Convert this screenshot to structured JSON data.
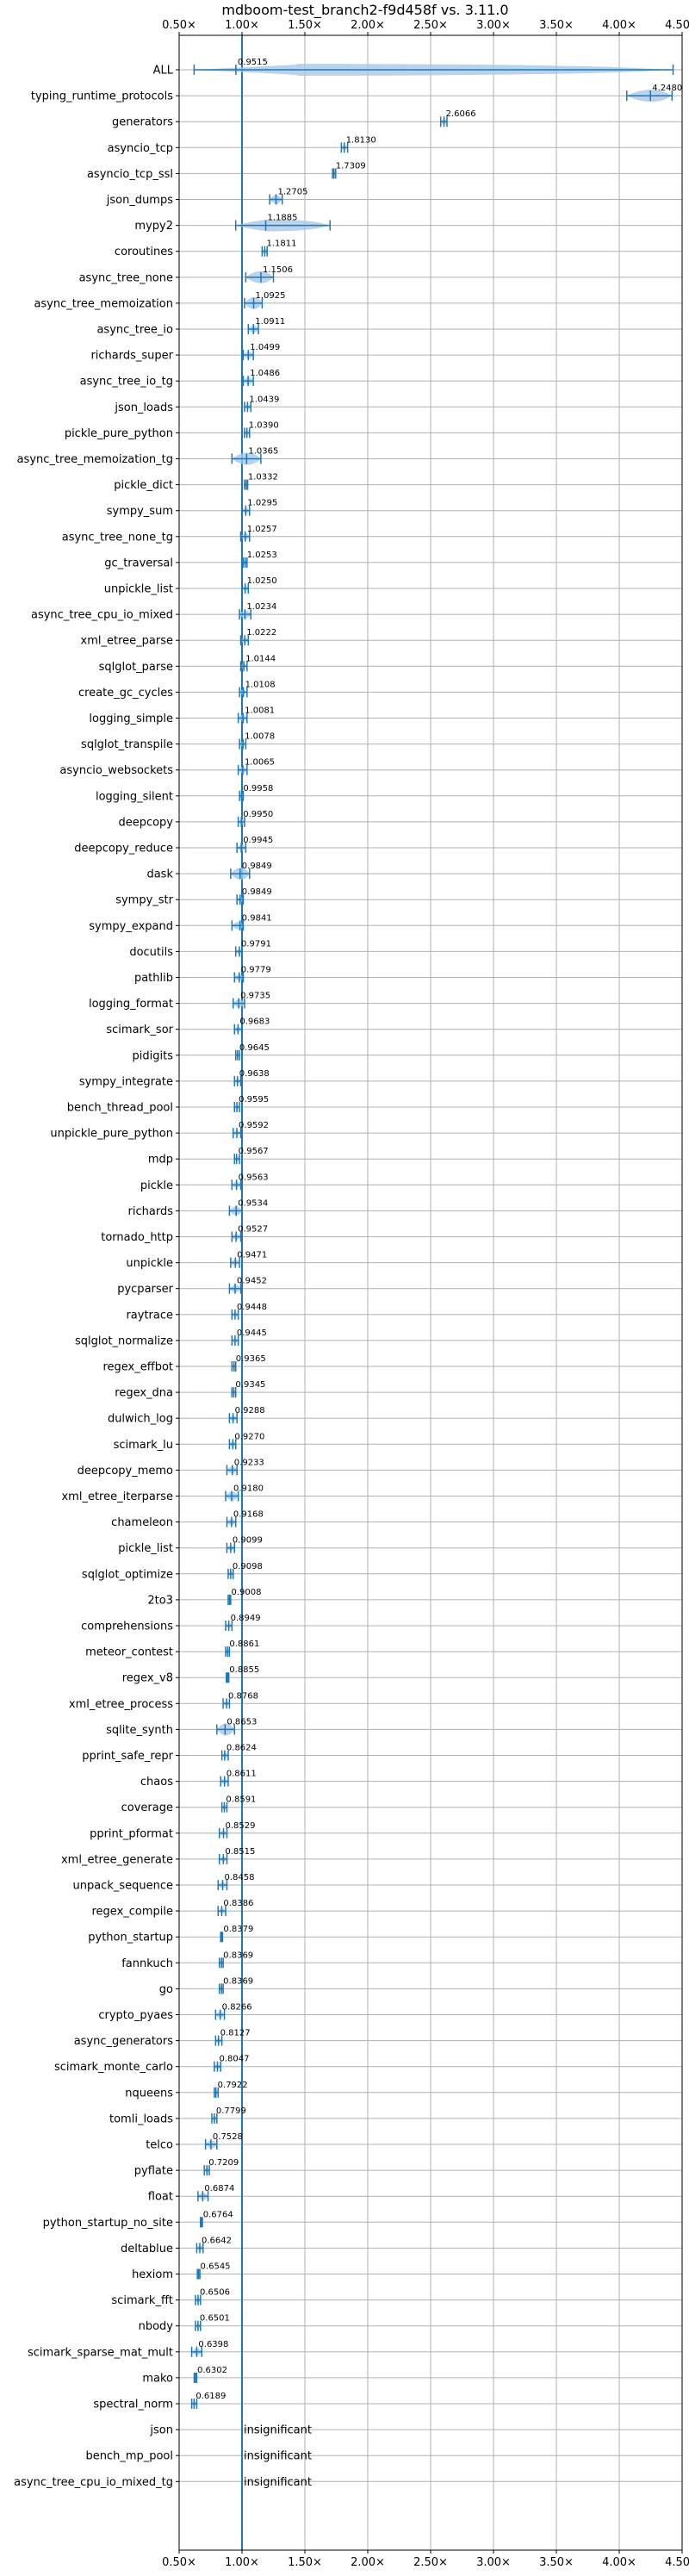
{
  "chart_data": {
    "type": "violin",
    "title": "mdboom-test_branch2-f9d458f vs. 3.11.0",
    "xlim": [
      0.5,
      4.5
    ],
    "x_scale": "linear",
    "x_ticks": [
      0.5,
      1.0,
      1.5,
      2.0,
      2.5,
      3.0,
      3.5,
      4.0,
      4.5
    ],
    "x_tick_labels": [
      "0.50×",
      "1.00×",
      "1.50×",
      "2.00×",
      "2.50×",
      "3.00×",
      "3.50×",
      "4.00×",
      "4.50×"
    ],
    "x_ticks_top_and_bottom": true,
    "grid": true,
    "reference_line": 1.0,
    "insignificant_label": "insignificant",
    "accent_color": "#1f77b4",
    "fill_color": "#a6c8e6",
    "benchmarks": [
      {
        "name": "ALL",
        "value": 0.9515,
        "label": "0.9515",
        "min": 0.6189,
        "max": 4.428
      },
      {
        "name": "typing_runtime_protocols",
        "value": 4.248,
        "label": "4.2480",
        "min": 4.06,
        "max": 4.42
      },
      {
        "name": "generators",
        "value": 2.6066,
        "label": "2.6066",
        "min": 2.58,
        "max": 2.63
      },
      {
        "name": "asyncio_tcp",
        "value": 1.813,
        "label": "1.8130",
        "min": 1.79,
        "max": 1.84
      },
      {
        "name": "asyncio_tcp_ssl",
        "value": 1.7309,
        "label": "1.7309",
        "min": 1.72,
        "max": 1.745
      },
      {
        "name": "json_dumps",
        "value": 1.2705,
        "label": "1.2705",
        "min": 1.22,
        "max": 1.32
      },
      {
        "name": "mypy2",
        "value": 1.1885,
        "label": "1.1885",
        "min": 0.95,
        "max": 1.7
      },
      {
        "name": "coroutines",
        "value": 1.1811,
        "label": "1.1811",
        "min": 1.16,
        "max": 1.2
      },
      {
        "name": "async_tree_none",
        "value": 1.1506,
        "label": "1.1506",
        "min": 1.03,
        "max": 1.25
      },
      {
        "name": "async_tree_memoization",
        "value": 1.0925,
        "label": "1.0925",
        "min": 1.02,
        "max": 1.16
      },
      {
        "name": "async_tree_io",
        "value": 1.0911,
        "label": "1.0911",
        "min": 1.05,
        "max": 1.13
      },
      {
        "name": "richards_super",
        "value": 1.0499,
        "label": "1.0499",
        "min": 1.01,
        "max": 1.09
      },
      {
        "name": "async_tree_io_tg",
        "value": 1.0486,
        "label": "1.0486",
        "min": 1.01,
        "max": 1.09
      },
      {
        "name": "json_loads",
        "value": 1.0439,
        "label": "1.0439",
        "min": 1.02,
        "max": 1.07
      },
      {
        "name": "pickle_pure_python",
        "value": 1.039,
        "label": "1.0390",
        "min": 1.02,
        "max": 1.06
      },
      {
        "name": "async_tree_memoization_tg",
        "value": 1.0365,
        "label": "1.0365",
        "min": 0.92,
        "max": 1.15
      },
      {
        "name": "pickle_dict",
        "value": 1.0332,
        "label": "1.0332",
        "min": 1.02,
        "max": 1.045
      },
      {
        "name": "sympy_sum",
        "value": 1.0295,
        "label": "1.0295",
        "min": 1.0,
        "max": 1.06
      },
      {
        "name": "async_tree_none_tg",
        "value": 1.0257,
        "label": "1.0257",
        "min": 0.99,
        "max": 1.06
      },
      {
        "name": "gc_traversal",
        "value": 1.0253,
        "label": "1.0253",
        "min": 1.01,
        "max": 1.04
      },
      {
        "name": "unpickle_list",
        "value": 1.025,
        "label": "1.0250",
        "min": 1.0,
        "max": 1.05
      },
      {
        "name": "async_tree_cpu_io_mixed",
        "value": 1.0234,
        "label": "1.0234",
        "min": 0.98,
        "max": 1.07
      },
      {
        "name": "xml_etree_parse",
        "value": 1.0222,
        "label": "1.0222",
        "min": 0.99,
        "max": 1.05
      },
      {
        "name": "sqlglot_parse",
        "value": 1.0144,
        "label": "1.0144",
        "min": 0.99,
        "max": 1.04
      },
      {
        "name": "create_gc_cycles",
        "value": 1.0108,
        "label": "1.0108",
        "min": 0.98,
        "max": 1.04
      },
      {
        "name": "logging_simple",
        "value": 1.0081,
        "label": "1.0081",
        "min": 0.97,
        "max": 1.04
      },
      {
        "name": "sqlglot_transpile",
        "value": 1.0078,
        "label": "1.0078",
        "min": 0.98,
        "max": 1.03
      },
      {
        "name": "asyncio_websockets",
        "value": 1.0065,
        "label": "1.0065",
        "min": 0.97,
        "max": 1.04
      },
      {
        "name": "logging_silent",
        "value": 0.9958,
        "label": "0.9958",
        "min": 0.98,
        "max": 1.01
      },
      {
        "name": "deepcopy",
        "value": 0.995,
        "label": "0.9950",
        "min": 0.97,
        "max": 1.02
      },
      {
        "name": "deepcopy_reduce",
        "value": 0.9945,
        "label": "0.9945",
        "min": 0.96,
        "max": 1.03
      },
      {
        "name": "dask",
        "value": 0.9849,
        "label": "0.9849",
        "min": 0.91,
        "max": 1.06
      },
      {
        "name": "sympy_str",
        "value": 0.9849,
        "label": "0.9849",
        "min": 0.96,
        "max": 1.01
      },
      {
        "name": "sympy_expand",
        "value": 0.9841,
        "label": "0.9841",
        "min": 0.92,
        "max": 1.01
      },
      {
        "name": "docutils",
        "value": 0.9791,
        "label": "0.9791",
        "min": 0.95,
        "max": 1.0
      },
      {
        "name": "pathlib",
        "value": 0.9779,
        "label": "0.9779",
        "min": 0.94,
        "max": 1.01
      },
      {
        "name": "logging_format",
        "value": 0.9735,
        "label": "0.9735",
        "min": 0.93,
        "max": 1.02
      },
      {
        "name": "scimark_sor",
        "value": 0.9683,
        "label": "0.9683",
        "min": 0.94,
        "max": 1.0
      },
      {
        "name": "pidigits",
        "value": 0.9645,
        "label": "0.9645",
        "min": 0.95,
        "max": 0.98
      },
      {
        "name": "sympy_integrate",
        "value": 0.9638,
        "label": "0.9638",
        "min": 0.94,
        "max": 0.99
      },
      {
        "name": "bench_thread_pool",
        "value": 0.9595,
        "label": "0.9595",
        "min": 0.94,
        "max": 0.98
      },
      {
        "name": "unpickle_pure_python",
        "value": 0.9592,
        "label": "0.9592",
        "min": 0.93,
        "max": 0.99
      },
      {
        "name": "mdp",
        "value": 0.9567,
        "label": "0.9567",
        "min": 0.94,
        "max": 0.98
      },
      {
        "name": "pickle",
        "value": 0.9563,
        "label": "0.9563",
        "min": 0.92,
        "max": 0.99
      },
      {
        "name": "richards",
        "value": 0.9534,
        "label": "0.9534",
        "min": 0.9,
        "max": 1.0
      },
      {
        "name": "tornado_http",
        "value": 0.9527,
        "label": "0.9527",
        "min": 0.92,
        "max": 0.99
      },
      {
        "name": "unpickle",
        "value": 0.9471,
        "label": "0.9471",
        "min": 0.91,
        "max": 0.98
      },
      {
        "name": "pycparser",
        "value": 0.9452,
        "label": "0.9452",
        "min": 0.9,
        "max": 0.99
      },
      {
        "name": "raytrace",
        "value": 0.9448,
        "label": "0.9448",
        "min": 0.92,
        "max": 0.97
      },
      {
        "name": "sqlglot_normalize",
        "value": 0.9445,
        "label": "0.9445",
        "min": 0.92,
        "max": 0.97
      },
      {
        "name": "regex_effbot",
        "value": 0.9365,
        "label": "0.9365",
        "min": 0.92,
        "max": 0.95
      },
      {
        "name": "regex_dna",
        "value": 0.9345,
        "label": "0.9345",
        "min": 0.92,
        "max": 0.95
      },
      {
        "name": "dulwich_log",
        "value": 0.9288,
        "label": "0.9288",
        "min": 0.9,
        "max": 0.96
      },
      {
        "name": "scimark_lu",
        "value": 0.927,
        "label": "0.9270",
        "min": 0.9,
        "max": 0.95
      },
      {
        "name": "deepcopy_memo",
        "value": 0.9233,
        "label": "0.9233",
        "min": 0.88,
        "max": 0.96
      },
      {
        "name": "xml_etree_iterparse",
        "value": 0.918,
        "label": "0.9180",
        "min": 0.87,
        "max": 0.97
      },
      {
        "name": "chameleon",
        "value": 0.9168,
        "label": "0.9168",
        "min": 0.88,
        "max": 0.95
      },
      {
        "name": "pickle_list",
        "value": 0.9099,
        "label": "0.9099",
        "min": 0.88,
        "max": 0.94
      },
      {
        "name": "sqlglot_optimize",
        "value": 0.9098,
        "label": "0.9098",
        "min": 0.89,
        "max": 0.93
      },
      {
        "name": "2to3",
        "value": 0.9008,
        "label": "0.9008",
        "min": 0.89,
        "max": 0.91
      },
      {
        "name": "comprehensions",
        "value": 0.8949,
        "label": "0.8949",
        "min": 0.87,
        "max": 0.92
      },
      {
        "name": "meteor_contest",
        "value": 0.8861,
        "label": "0.8861",
        "min": 0.87,
        "max": 0.9
      },
      {
        "name": "regex_v8",
        "value": 0.8855,
        "label": "0.8855",
        "min": 0.875,
        "max": 0.895
      },
      {
        "name": "xml_etree_process",
        "value": 0.8768,
        "label": "0.8768",
        "min": 0.85,
        "max": 0.9
      },
      {
        "name": "sqlite_synth",
        "value": 0.8653,
        "label": "0.8653",
        "min": 0.8,
        "max": 0.94
      },
      {
        "name": "pprint_safe_repr",
        "value": 0.8624,
        "label": "0.8624",
        "min": 0.84,
        "max": 0.89
      },
      {
        "name": "chaos",
        "value": 0.8611,
        "label": "0.8611",
        "min": 0.83,
        "max": 0.89
      },
      {
        "name": "coverage",
        "value": 0.8591,
        "label": "0.8591",
        "min": 0.84,
        "max": 0.88
      },
      {
        "name": "pprint_pformat",
        "value": 0.8529,
        "label": "0.8529",
        "min": 0.82,
        "max": 0.88
      },
      {
        "name": "xml_etree_generate",
        "value": 0.8515,
        "label": "0.8515",
        "min": 0.82,
        "max": 0.88
      },
      {
        "name": "unpack_sequence",
        "value": 0.8458,
        "label": "0.8458",
        "min": 0.81,
        "max": 0.88
      },
      {
        "name": "regex_compile",
        "value": 0.8386,
        "label": "0.8386",
        "min": 0.81,
        "max": 0.87
      },
      {
        "name": "python_startup",
        "value": 0.8379,
        "label": "0.8379",
        "min": 0.83,
        "max": 0.845
      },
      {
        "name": "fannkuch",
        "value": 0.8369,
        "label": "0.8369",
        "min": 0.82,
        "max": 0.85
      },
      {
        "name": "go",
        "value": 0.8369,
        "label": "0.8369",
        "min": 0.82,
        "max": 0.85
      },
      {
        "name": "crypto_pyaes",
        "value": 0.8266,
        "label": "0.8266",
        "min": 0.79,
        "max": 0.86
      },
      {
        "name": "async_generators",
        "value": 0.8127,
        "label": "0.8127",
        "min": 0.79,
        "max": 0.84
      },
      {
        "name": "scimark_monte_carlo",
        "value": 0.8047,
        "label": "0.8047",
        "min": 0.78,
        "max": 0.83
      },
      {
        "name": "nqueens",
        "value": 0.7922,
        "label": "0.7922",
        "min": 0.78,
        "max": 0.81
      },
      {
        "name": "tomli_loads",
        "value": 0.7799,
        "label": "0.7799",
        "min": 0.76,
        "max": 0.8
      },
      {
        "name": "telco",
        "value": 0.7528,
        "label": "0.7528",
        "min": 0.71,
        "max": 0.8
      },
      {
        "name": "pyflate",
        "value": 0.7209,
        "label": "0.7209",
        "min": 0.7,
        "max": 0.74
      },
      {
        "name": "float",
        "value": 0.6874,
        "label": "0.6874",
        "min": 0.65,
        "max": 0.73
      },
      {
        "name": "python_startup_no_site",
        "value": 0.6764,
        "label": "0.6764",
        "min": 0.67,
        "max": 0.685
      },
      {
        "name": "deltablue",
        "value": 0.6642,
        "label": "0.6642",
        "min": 0.64,
        "max": 0.69
      },
      {
        "name": "hexiom",
        "value": 0.6545,
        "label": "0.6545",
        "min": 0.645,
        "max": 0.665
      },
      {
        "name": "scimark_fft",
        "value": 0.6506,
        "label": "0.6506",
        "min": 0.63,
        "max": 0.67
      },
      {
        "name": "nbody",
        "value": 0.6501,
        "label": "0.6501",
        "min": 0.63,
        "max": 0.67
      },
      {
        "name": "scimark_sparse_mat_mult",
        "value": 0.6398,
        "label": "0.6398",
        "min": 0.6,
        "max": 0.68
      },
      {
        "name": "mako",
        "value": 0.6302,
        "label": "0.6302",
        "min": 0.62,
        "max": 0.64
      },
      {
        "name": "spectral_norm",
        "value": 0.6189,
        "label": "0.6189",
        "min": 0.6,
        "max": 0.64
      },
      {
        "name": "json",
        "value": null,
        "insignificant": true
      },
      {
        "name": "bench_mp_pool",
        "value": null,
        "insignificant": true
      },
      {
        "name": "async_tree_cpu_io_mixed_tg",
        "value": null,
        "insignificant": true
      }
    ]
  }
}
